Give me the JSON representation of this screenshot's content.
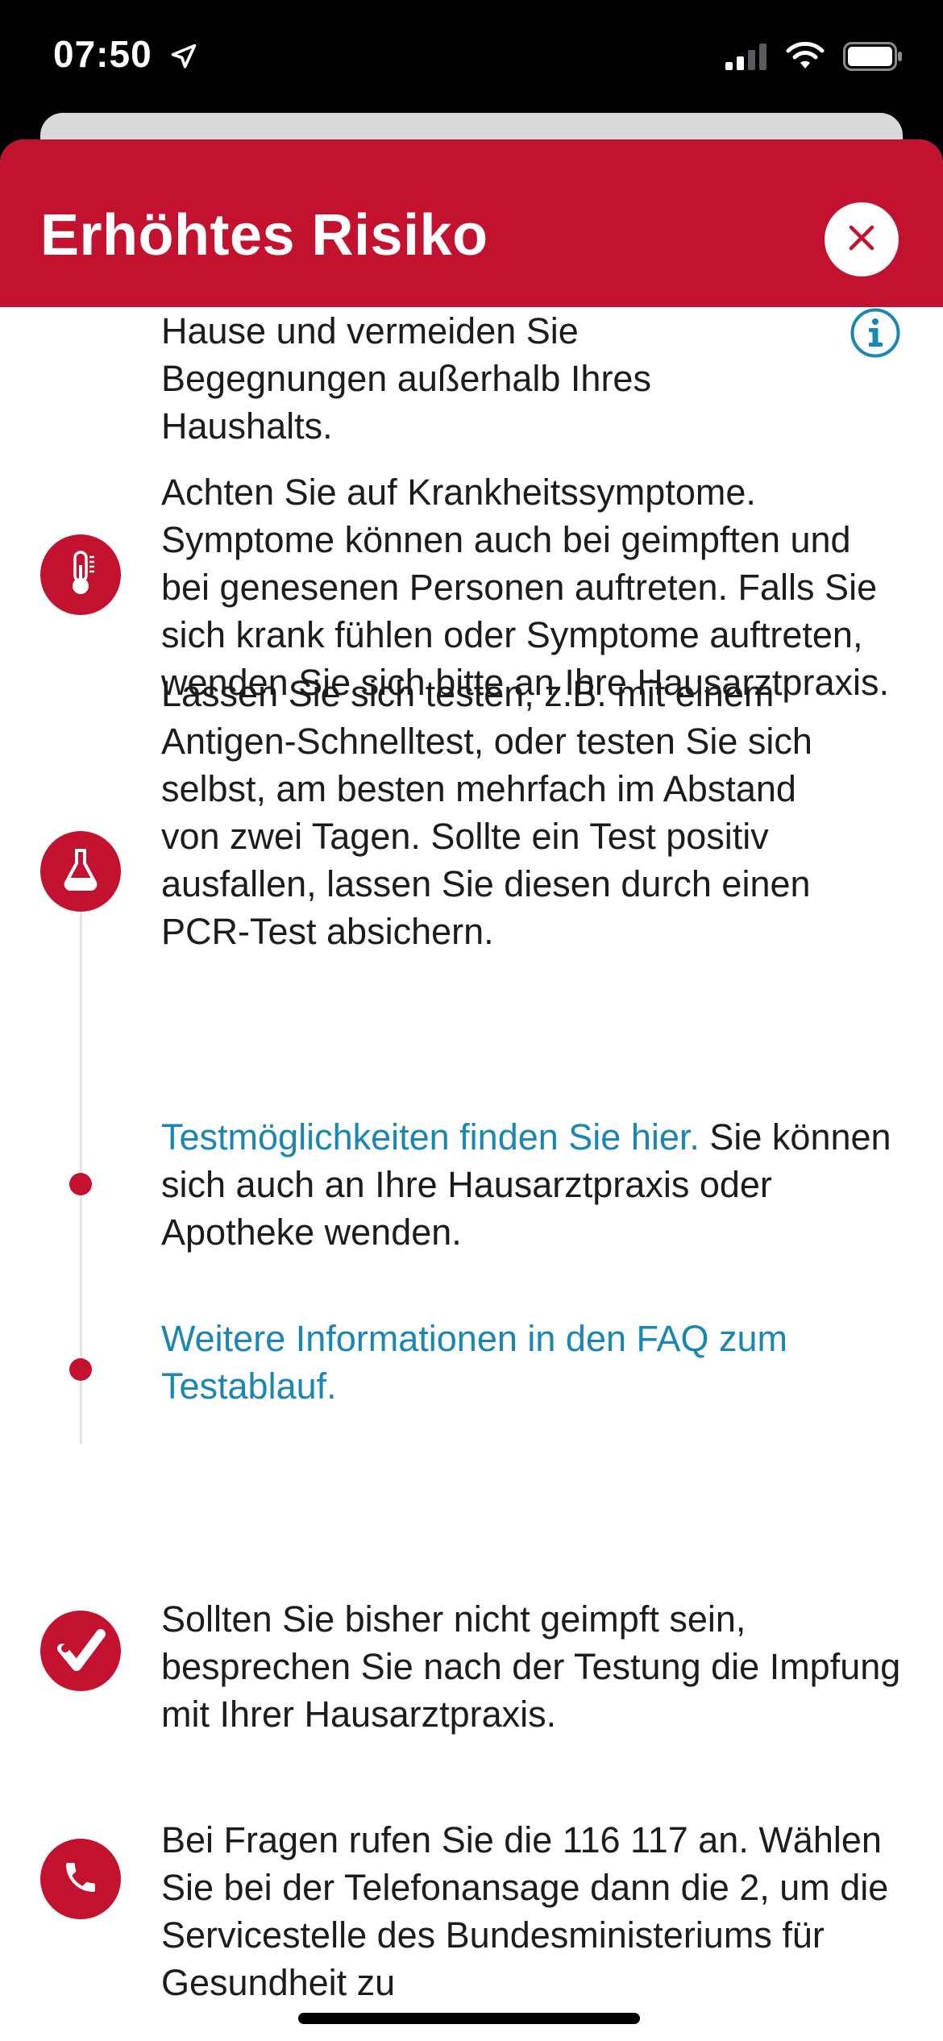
{
  "status_bar": {
    "time": "07:50",
    "location_icon": "location-arrow-icon",
    "signal_icon": "cellular-signal-icon",
    "wifi_icon": "wifi-icon",
    "battery_icon": "battery-icon"
  },
  "header": {
    "title": "Erhöhtes Risiko",
    "close_icon": "close-icon",
    "color": "#c3122f"
  },
  "steps": {
    "home": {
      "text": "Hause und vermeiden Sie Begegnungen außerhalb Ihres Haushalts.",
      "info_icon": "info-icon"
    },
    "symptoms": {
      "icon": "thermometer-icon",
      "text": "Achten Sie auf Krankheitssymptome. Symptome können auch bei geimpften und bei genesenen Personen auftreten. Falls Sie sich krank fühlen oder Symptome auftreten, wenden Sie sich bitte an Ihre Hausarztpraxis."
    },
    "test": {
      "icon": "test-flask-icon",
      "text": "Lassen Sie sich testen, z.B. mit einem Antigen-Schnelltest, oder testen Sie sich selbst, am besten mehrfach im Abstand von zwei Tagen. Sollte ein Test positiv ausfallen, lassen Sie diesen durch einen PCR-Test absichern."
    },
    "test_locations": {
      "link": "Testmöglichkeiten finden Sie hier.",
      "text": " Sie können sich auch an Ihre Hausarztpraxis oder Apotheke wenden."
    },
    "faq": {
      "link": "Weitere Informationen in den FAQ zum Testablauf."
    },
    "vaccination": {
      "icon": "vaccination-syringe-icon",
      "text": "Sollten Sie bisher nicht geimpft sein, besprechen Sie nach der Testung die Impfung mit Ihrer Hausarztpraxis."
    },
    "hotline": {
      "icon": "phone-icon",
      "text": "Bei Fragen rufen Sie die 116 117 an. Wählen Sie bei der Telefonansage dann die 2, um die Servicestelle des Bundesministeriums für Gesundheit zu"
    }
  },
  "colors": {
    "accent": "#c3122f",
    "link": "#1a86b3",
    "text": "#1c1c1e"
  }
}
